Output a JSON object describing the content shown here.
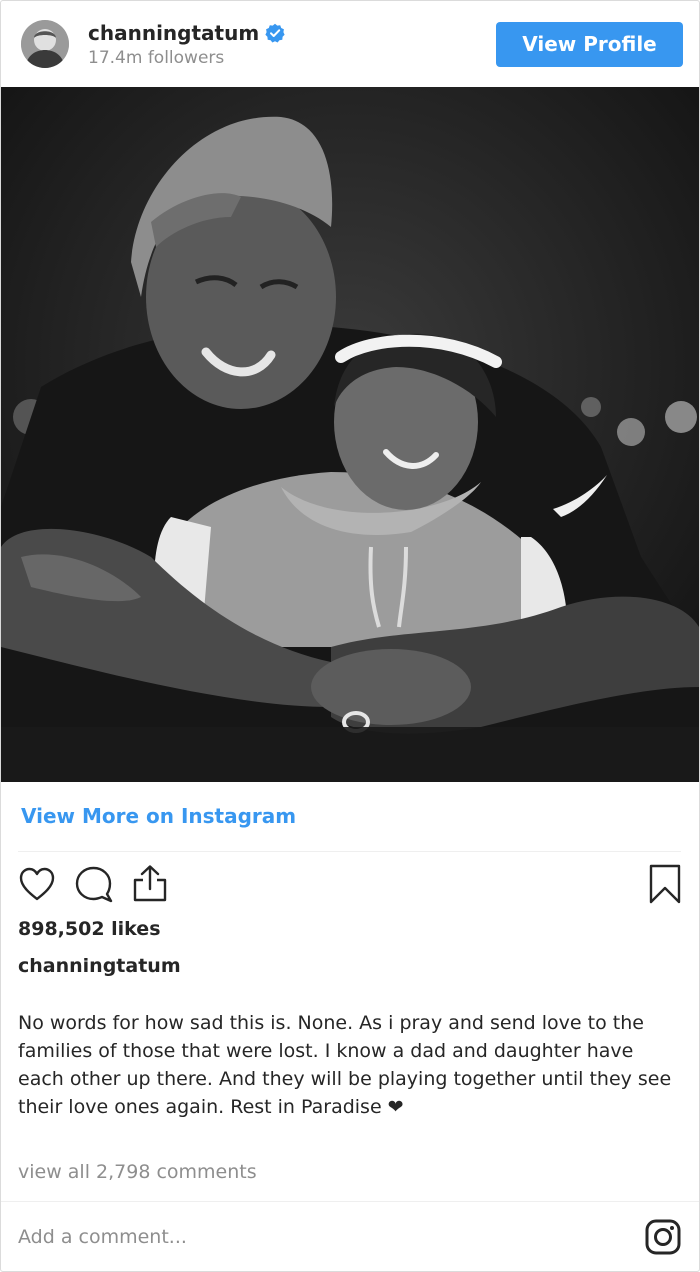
{
  "header": {
    "username": "channingtatum",
    "followers": "17.4m followers",
    "view_profile_label": "View Profile",
    "verified_icon": "verified-badge-icon",
    "avatar_icon": "avatar"
  },
  "post": {
    "view_more_label": "View More on Instagram",
    "likes": "898,502 likes",
    "caption_user": "channingtatum",
    "caption": "No words for how sad this is. None. As i pray and send love to the families of those that were lost. I know a dad and daughter have each other up there. And they will be playing together until they see their love ones again. Rest in Paradise ❤",
    "view_comments": "view all 2,798 comments",
    "add_comment_placeholder": "Add a comment..."
  },
  "icons": {
    "like": "heart-icon",
    "comment": "comment-icon",
    "share": "share-icon",
    "save": "bookmark-icon",
    "brand": "instagram-logo-icon"
  },
  "colors": {
    "accent": "#3897f0",
    "text": "#262626",
    "muted": "#8e8e8e"
  }
}
